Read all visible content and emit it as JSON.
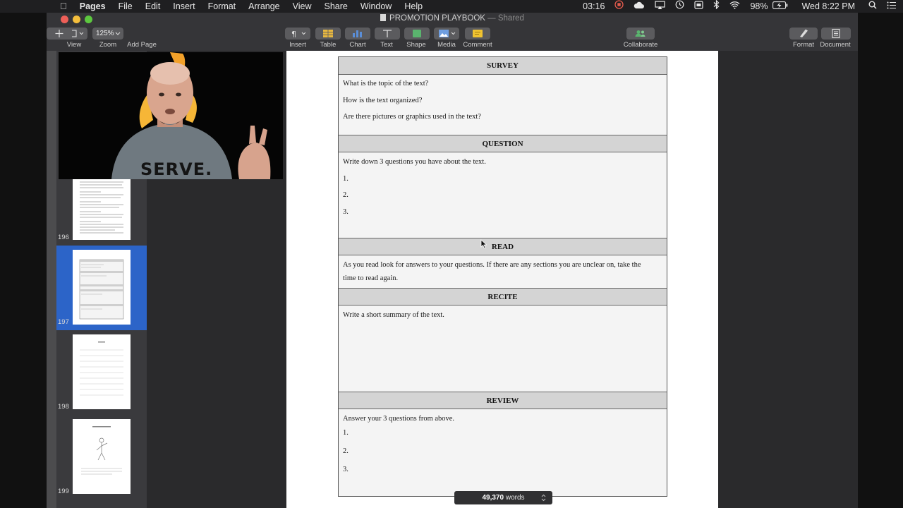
{
  "menubar": {
    "app_name": "Pages",
    "items": [
      "File",
      "Edit",
      "Insert",
      "Format",
      "Arrange",
      "View",
      "Share",
      "Window",
      "Help"
    ],
    "timer": "03:16",
    "battery": "98%",
    "clock": "Wed 8:22 PM"
  },
  "window": {
    "title": "PROMOTION PLAYBOOK",
    "shared_label": "— Shared"
  },
  "toolbar": {
    "view": "View",
    "zoom_value": "125%",
    "zoom": "Zoom",
    "add_page": "Add Page",
    "insert": "Insert",
    "table": "Table",
    "chart": "Chart",
    "text": "Text",
    "shape": "Shape",
    "media": "Media",
    "comment": "Comment",
    "collaborate": "Collaborate",
    "format": "Format",
    "document": "Document"
  },
  "sidebar": {
    "pages": [
      "196",
      "197",
      "198",
      "199"
    ],
    "selected_page": "197"
  },
  "video": {
    "shirt_text": "SERVE."
  },
  "document": {
    "sections": [
      {
        "heading": "SURVEY",
        "lines": [
          "What is the topic of the text?",
          "How is the text organized?",
          "Are there pictures or graphics used in the text?"
        ]
      },
      {
        "heading": "QUESTION",
        "lines": [
          "Write down 3 questions you have about the text.",
          "1.",
          "2.",
          "3."
        ]
      },
      {
        "heading": "READ",
        "lines": [
          "As you read look for answers to your questions. If there are any sections you are unclear on, take the",
          "time to read again."
        ]
      },
      {
        "heading": "RECITE",
        "lines": [
          "Write a short summary of the text."
        ]
      },
      {
        "heading": "REVIEW",
        "lines": [
          "Answer your 3 questions from above.",
          "1.",
          "2.",
          "3."
        ]
      }
    ]
  },
  "status": {
    "word_count": "49,370",
    "words_label": "words"
  },
  "colors": {
    "selection_blue": "#2c64c8",
    "comment_yellow": "#f0c330",
    "collaborate_green": "#5ab46e"
  }
}
